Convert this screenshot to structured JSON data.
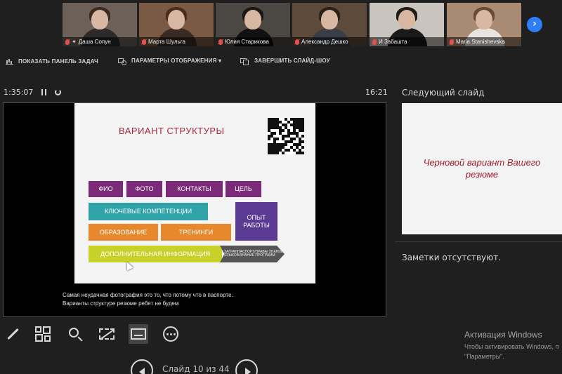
{
  "participants": [
    {
      "name": "Даша Сопун",
      "pinned": true,
      "bg": "#6b6158",
      "hair": "#3b2b22",
      "shirt": "#2e2a2a"
    },
    {
      "name": "Марта Шульга",
      "pinned": false,
      "bg": "#7a5a44",
      "hair": "#4a2d1e",
      "shirt": "#3a2a24"
    },
    {
      "name": "Юлия Старикова",
      "pinned": false,
      "bg": "#4b4742",
      "hair": "#1e1714",
      "shirt": "#111111"
    },
    {
      "name": "Александр Дешко",
      "pinned": false,
      "bg": "#5d4a3b",
      "hair": "#2b211b",
      "shirt": "#3a3d46"
    },
    {
      "name": "И Забашта",
      "pinned": false,
      "bg": "#c9c4bd",
      "hair": "#1e1a17",
      "shirt": "#1a1a1a"
    },
    {
      "name": "Maria Stanishevska",
      "pinned": false,
      "bg": "#a88b72",
      "hair": "#6a4a32",
      "shirt": "#e8e4df"
    }
  ],
  "toolbar": {
    "taskbar": "ПОКАЗАТЬ ПАНЕЛЬ ЗАДАЧ",
    "display": "ПАРАМЕТРЫ ОТОБРАЖЕНИЯ ▾",
    "end": "ЗАВЕРШИТЬ СЛАЙД-ШОУ"
  },
  "timer": "1:35:07",
  "clock": "16:21",
  "current_slide": {
    "title": "ВАРИАНТ СТРУКТУРЫ",
    "blocks": {
      "fio": "ФИО",
      "photo": "ФОТО",
      "contacts": "КОНТАКТЫ",
      "goal": "ЦЕЛЬ",
      "competencies": "КЛЮЧЕВЫЕ КОМПЕТЕНЦИИ",
      "experience": "ОПЫТ РАБОТЫ",
      "education": "ОБРАЗОВАНИЕ",
      "trainings": "ТРЕНИНГИ",
      "additional": "ДОПОЛНИТЕЛЬНАЯ ИНФОРМАЦИЯ",
      "arrow": "ЗАГРАНПАСПОРТ/ПРАВА/ ЗНАНИЕ ЯЗЫКОВ/ЗНАНИЕ ПРОГРАММ"
    },
    "colors": {
      "purple": "#7b2a7a",
      "teal": "#2fa3a8",
      "orange": "#e7882c",
      "violet": "#5b3a94",
      "lime": "#c8d12a"
    }
  },
  "speaker_notes": {
    "line1": "Самая неудачная фотография это то, что потому что в паспорте.",
    "line2": "Варианты структуре резюме ребят не будем"
  },
  "tools": [
    "pen-icon",
    "slides-grid-icon",
    "zoom-icon",
    "black-screen-icon",
    "subtitles-icon",
    "more-icon"
  ],
  "slide_counter": "Слайд 10 из 44",
  "next_slide": {
    "label": "Следующий слайд",
    "text": "Черновой вариант Вашего резюме"
  },
  "notes_panel": "Заметки отсутствуют.",
  "watermark": {
    "title": "Активация Windows",
    "line1": "Чтобы активировать Windows, п",
    "line2": "\"Параметры\"."
  }
}
